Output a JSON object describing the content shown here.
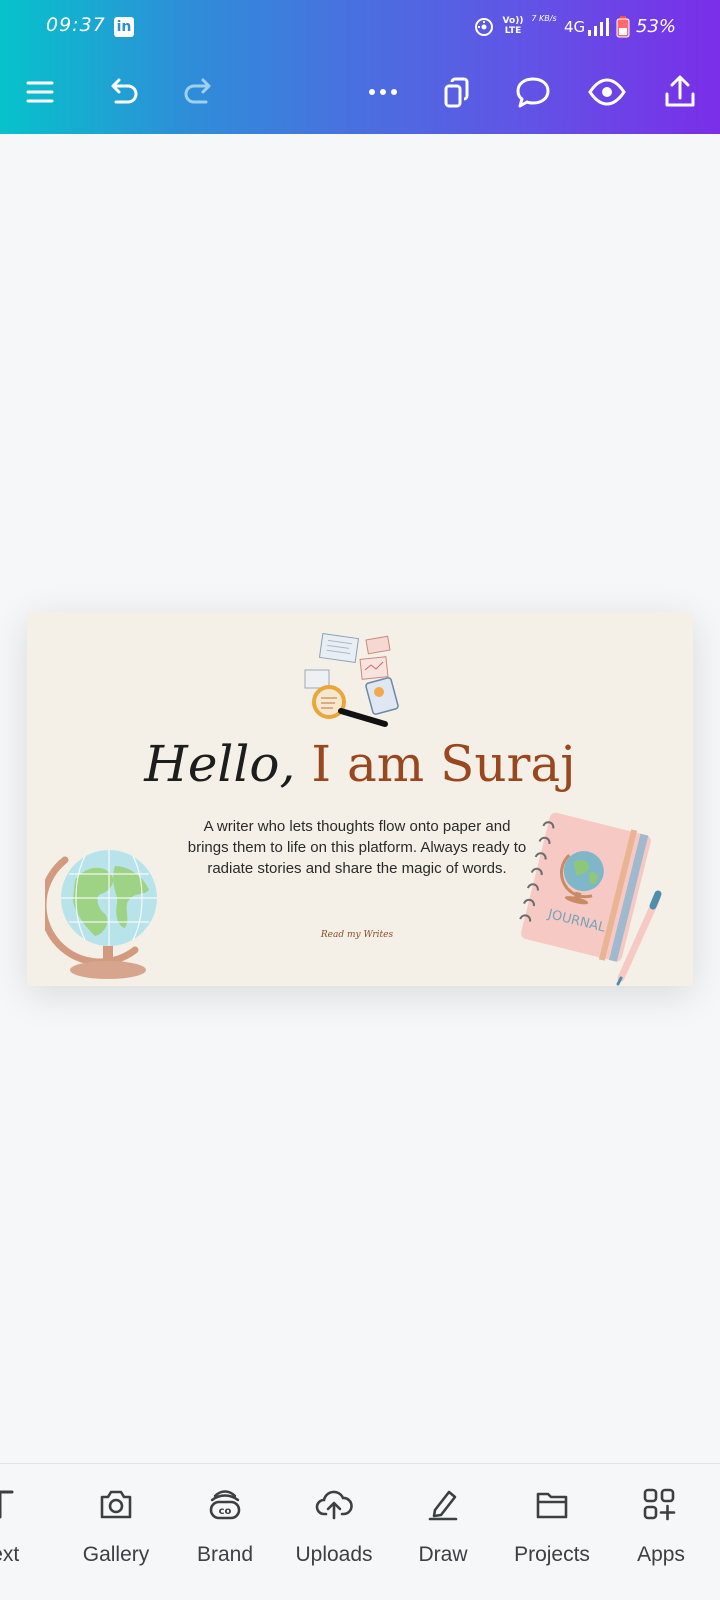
{
  "status_bar": {
    "time": "09:37",
    "linkedin_badge": "in",
    "volte": "Vo)) LTE",
    "speed": "7 KB/s",
    "network": "4G",
    "battery": "53%"
  },
  "toolbar": {
    "icons": [
      "menu-icon",
      "undo-icon",
      "redo-icon",
      "more-icon",
      "pages-icon",
      "comment-icon",
      "preview-icon",
      "share-icon"
    ]
  },
  "design": {
    "headline_hello": "Hello,",
    "headline_name": "I am Suraj",
    "bio": "A writer who lets thoughts flow onto paper and brings them to life on this platform. Always ready to radiate stories and share the magic of words.",
    "read_link": "Read my Writes",
    "journal_label": "JOURNAL",
    "background": "#f5f0e7",
    "accent": "#99471e"
  },
  "bottom_nav": {
    "items": [
      {
        "label": "Text",
        "icon": "text-icon"
      },
      {
        "label": "Gallery",
        "icon": "camera-icon"
      },
      {
        "label": "Brand",
        "icon": "brand-icon"
      },
      {
        "label": "Uploads",
        "icon": "upload-cloud-icon"
      },
      {
        "label": "Draw",
        "icon": "pen-icon"
      },
      {
        "label": "Projects",
        "icon": "folder-icon"
      },
      {
        "label": "Apps",
        "icon": "apps-icon"
      }
    ]
  }
}
